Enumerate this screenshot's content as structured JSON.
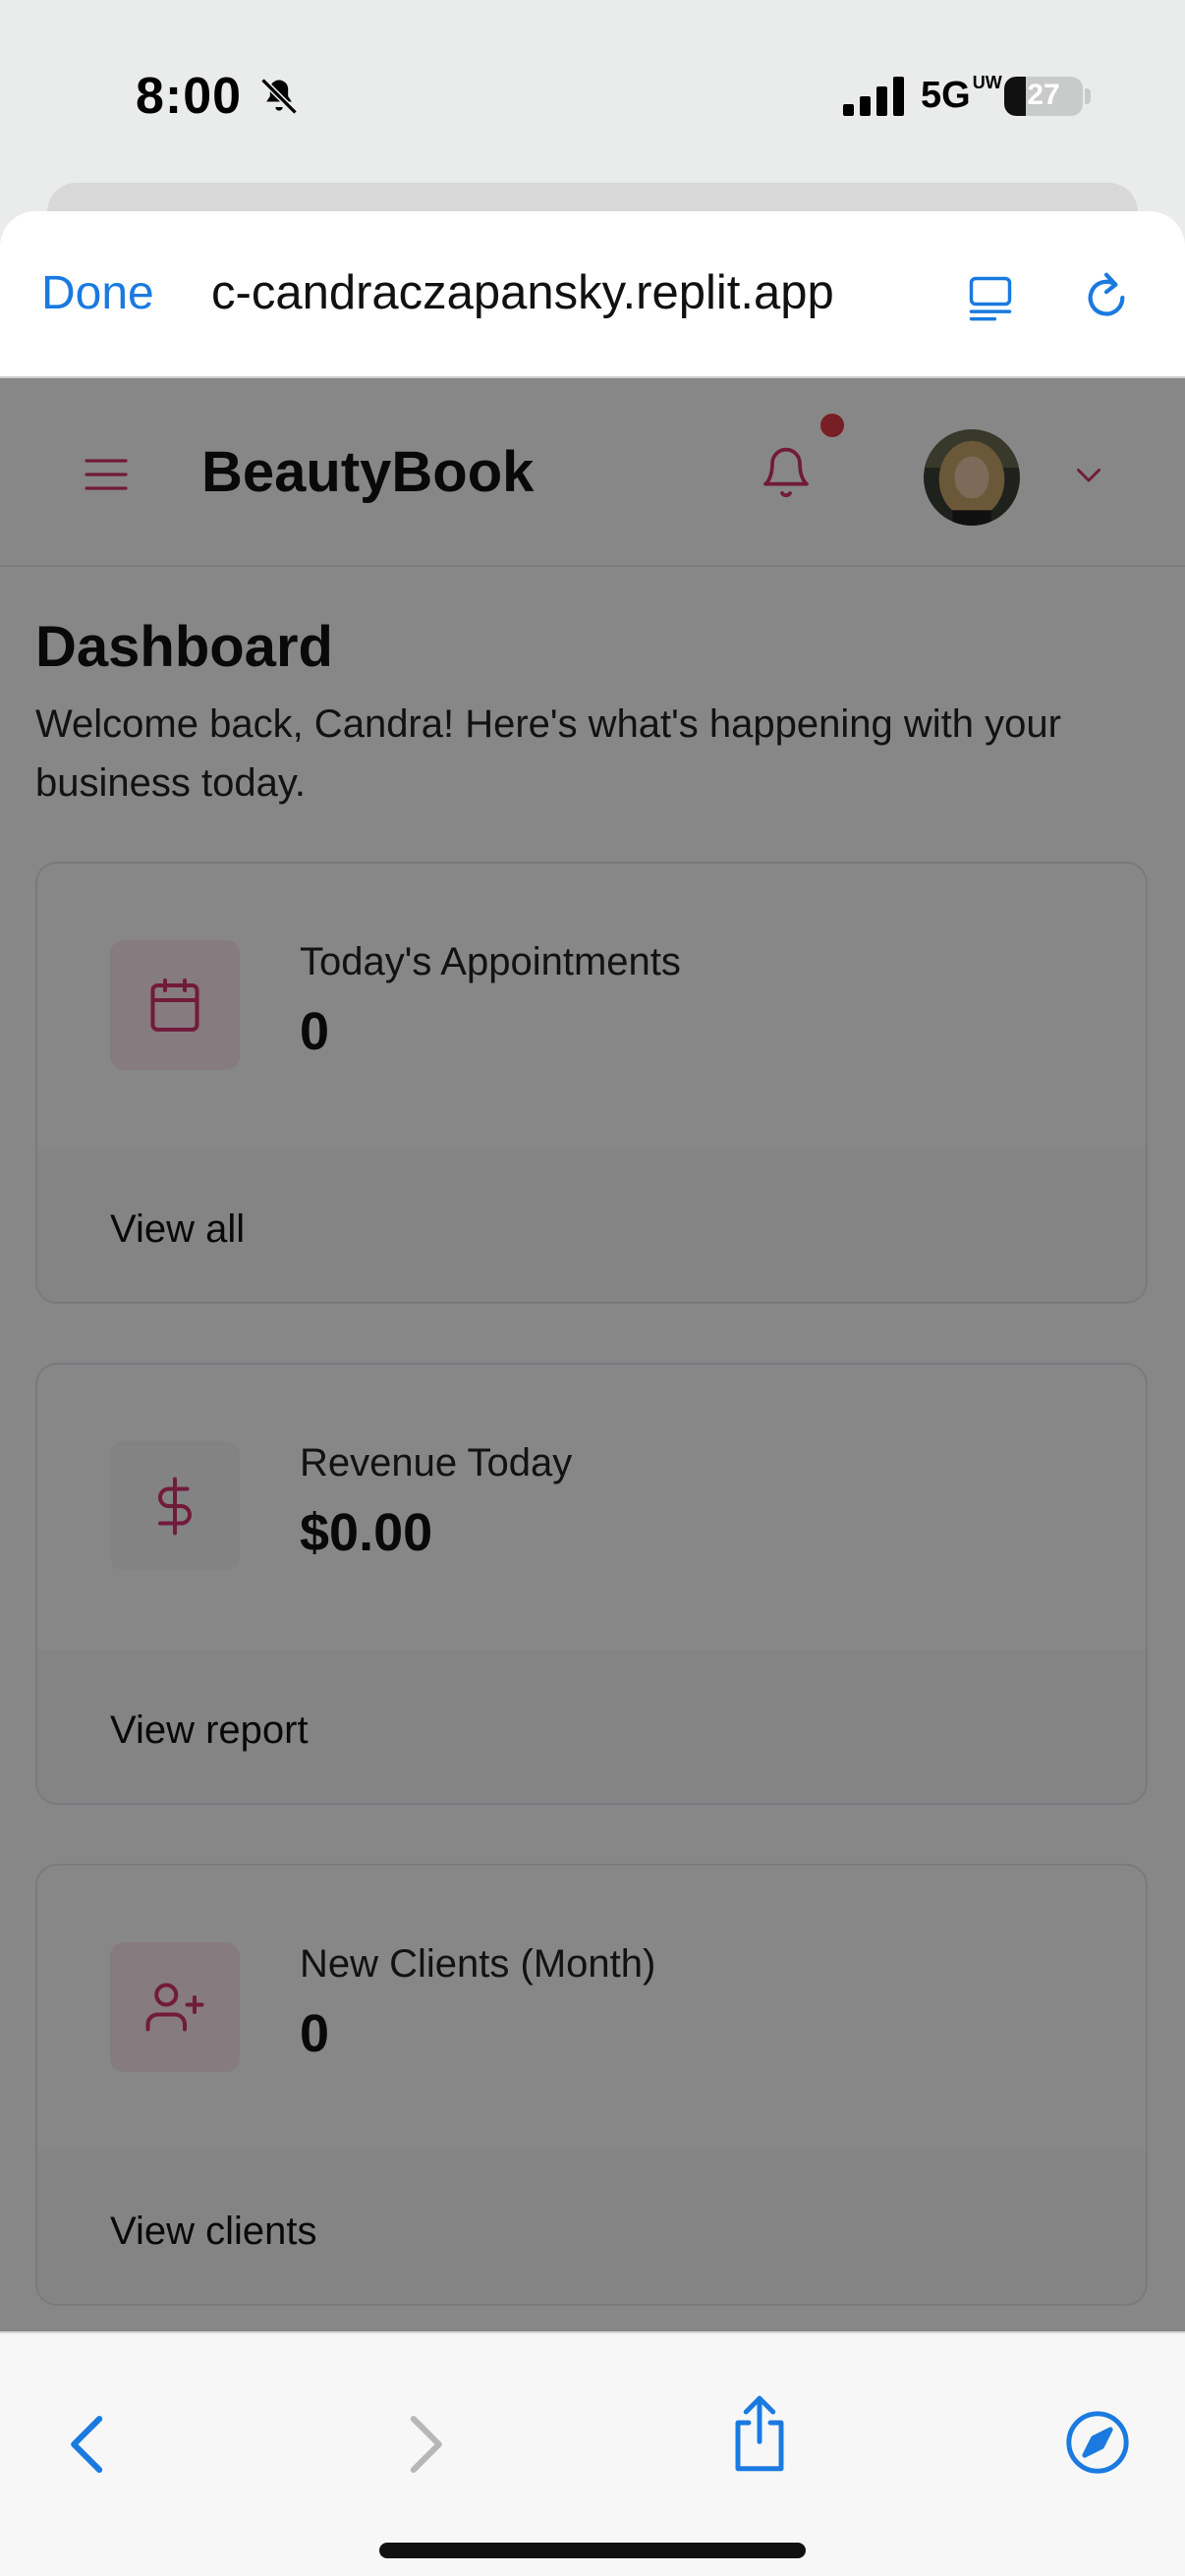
{
  "status_bar": {
    "time": "8:00",
    "network": "5G",
    "network_sup": "UW",
    "battery": "27",
    "battery_level": 0.27
  },
  "browser": {
    "done_label": "Done",
    "url": "c-candraczapansky.replit.app",
    "reader_icon": "reader-mode-icon",
    "reload_icon": "reload-icon"
  },
  "header": {
    "brand": "BeautyBook",
    "menu_icon": "hamburger-menu-icon",
    "notification_icon": "bell-icon",
    "has_unread": true
  },
  "dashboard": {
    "title": "Dashboard",
    "welcome": "Welcome back, Candra! Here's what's happening with your business today."
  },
  "cards": [
    {
      "label": "Today's Appointments",
      "value": "0",
      "link": "View all",
      "icon": "calendar-icon"
    },
    {
      "label": "Revenue Today",
      "value": "$0.00",
      "link": "View report",
      "icon": "dollar-icon"
    },
    {
      "label": "New Clients (Month)",
      "value": "0",
      "link": "View clients",
      "icon": "user-plus-icon"
    }
  ],
  "colors": {
    "accent": "#d6336c",
    "ios_blue": "#1a7ae0",
    "notification_dot": "#e23b48"
  }
}
